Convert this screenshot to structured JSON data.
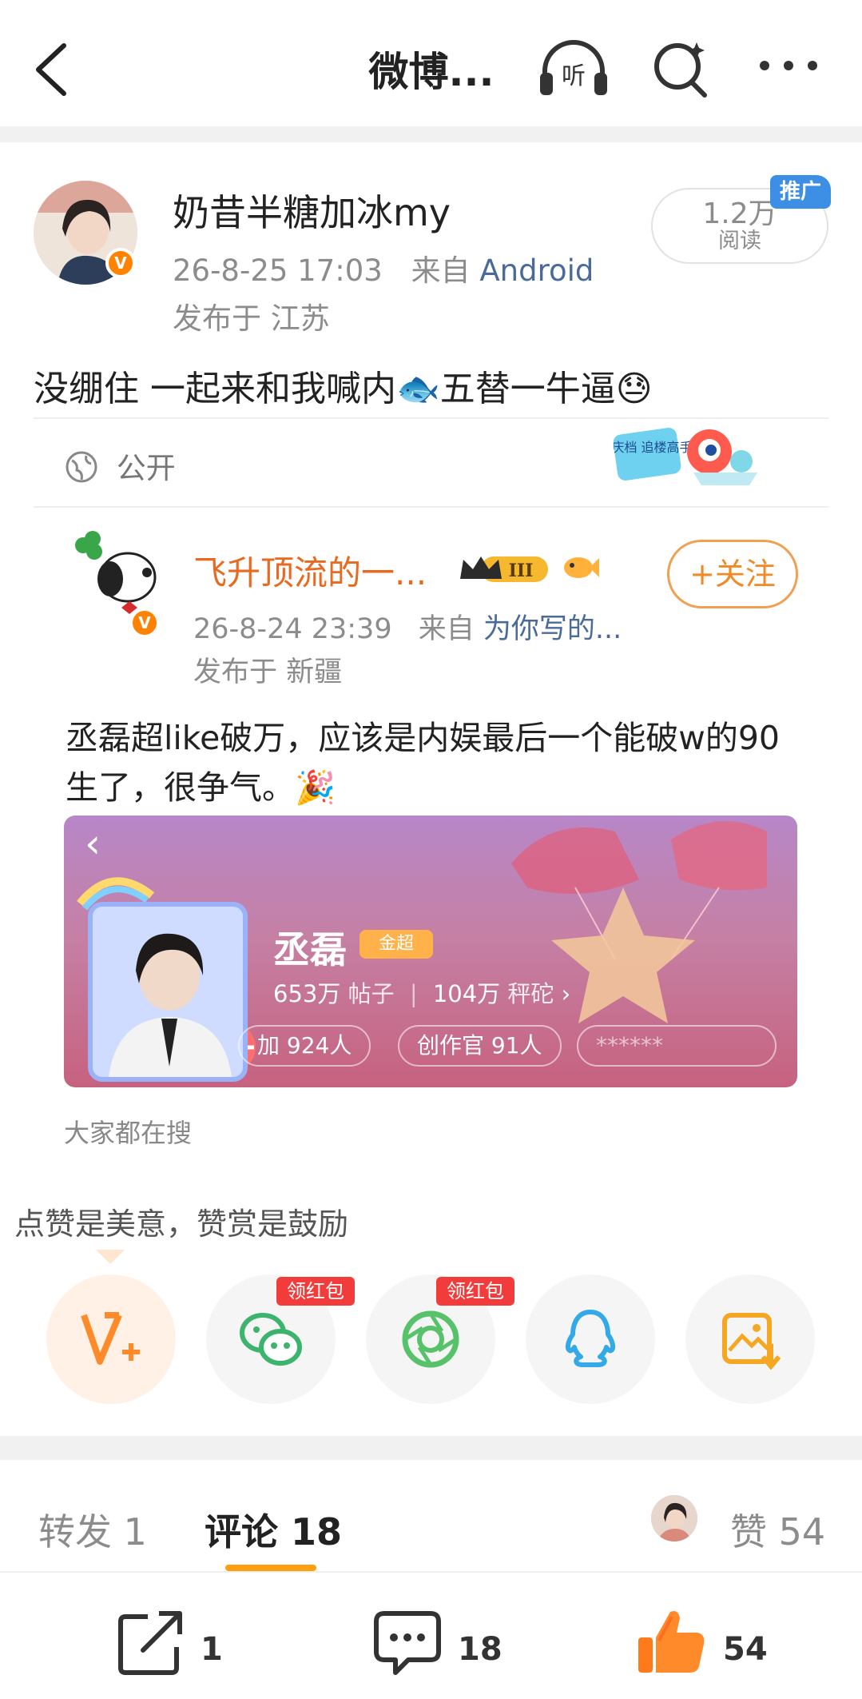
{
  "topbar": {
    "title": "微博...",
    "listen_label": "听"
  },
  "post": {
    "author": "奶昔半糖加冰my",
    "time": "26-8-25 17:03",
    "source_prefix": "来自",
    "source": "Android",
    "location": "发布于 江苏",
    "reads_count": "1.2万",
    "reads_label": "阅读",
    "promo_badge": "推广",
    "text": "没绷住 一起来和我喊内🐟五替一牛逼😓",
    "visibility": "公开",
    "sticker_text": "国庆档 追楼高手"
  },
  "repost": {
    "author": "飞升顶流的一...",
    "level_badge": "III",
    "follow_label": "+关注",
    "time": "26-8-24 23:39",
    "source_prefix": "来自",
    "source": "为你写的...",
    "location": "发布于 新疆",
    "text": "丞磊超like破万，应该是内娱最后一个能破w的90生了，很争气。🎉",
    "card": {
      "name": "丞磊",
      "tier": "金超",
      "posts_value": "653万",
      "posts_label": "帖子",
      "followers_value": "104万",
      "followers_label": "秤砣",
      "pill_1": "加 924人",
      "pill_2": "创作官 91人",
      "pill_3": "******"
    },
    "trending": "大家都在搜"
  },
  "reward": {
    "tip": "点赞是美意，赞赏是鼓励",
    "red_packet_label": "领红包",
    "share_targets": [
      "reward-v-plus",
      "wechat",
      "moments",
      "qq",
      "save-image"
    ]
  },
  "tabs": {
    "repost": "转发 1",
    "comments": "评论 18",
    "likes": "赞 54"
  },
  "bottom": {
    "repost_count": "1",
    "comment_count": "18",
    "like_count": "54"
  },
  "colors": {
    "orange": "#ff8200",
    "link_blue": "#4a6b9a",
    "follow_orange": "#f08a24",
    "red_tag": "#f23c3c",
    "tab_underline": "#ff9e0f"
  }
}
